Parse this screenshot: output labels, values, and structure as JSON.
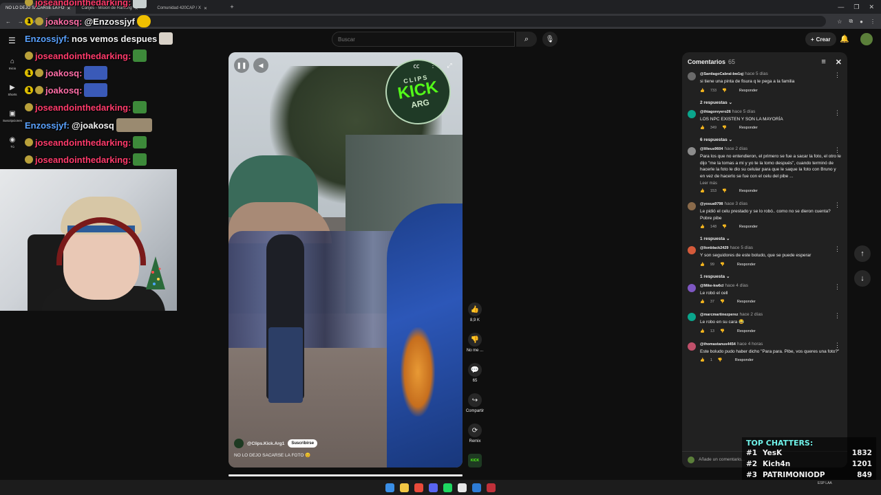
{
  "browser": {
    "tabs": [
      {
        "label": "NO LO DEJO SACARSE LA FO",
        "active": true
      },
      {
        "label": "Canjes - Misión de Ranking",
        "active": false
      },
      {
        "label": "Comunidad 420CAP / X",
        "active": false
      }
    ],
    "new_tab": "+",
    "win_controls": [
      "—",
      "❐",
      "✕"
    ]
  },
  "youtube": {
    "search_placeholder": "Buscar",
    "create_label": "Crear",
    "nav": [
      {
        "label": "Inicio",
        "icon": "home-icon",
        "glyph": "⌂"
      },
      {
        "label": "Shorts",
        "icon": "shorts-icon",
        "glyph": "▶"
      },
      {
        "label": "Suscripciones",
        "icon": "subscriptions-icon",
        "glyph": "▣"
      },
      {
        "label": "Tú",
        "icon": "you-icon",
        "glyph": "◉"
      }
    ]
  },
  "stream_chat": [
    {
      "user": "joseandointhedarking:",
      "color": "#ff3b6b",
      "msg": ""
    },
    {
      "user": "joakosq:",
      "color": "#ff6fa8",
      "msg": "@Enzossjyf"
    },
    {
      "user": "Enzossjyf:",
      "color": "#5aa2ff",
      "msg": "nos vemos despues"
    },
    {
      "user": "joseandointhedarking:",
      "color": "#ff3b6b",
      "msg": ""
    },
    {
      "user": "joakosq:",
      "color": "#ff6fa8",
      "msg": ""
    },
    {
      "user": "joakosq:",
      "color": "#ff6fa8",
      "msg": ""
    },
    {
      "user": "joseandointhedarking:",
      "color": "#ff3b6b",
      "msg": ""
    },
    {
      "user": "Enzossjyf:",
      "color": "#5aa2ff",
      "msg": "@joakosq"
    },
    {
      "user": "joseandointhedarking:",
      "color": "#ff3b6b",
      "msg": ""
    },
    {
      "user": "joseandointhedarking:",
      "color": "#ff3b6b",
      "msg": ""
    }
  ],
  "video": {
    "logo_top": "CLIPS",
    "logo_mid": "KICK",
    "logo_bot": "ARG",
    "channel": "@Clips.Kick.Arg1",
    "subscribe": "Suscribirse",
    "title": "NO LO DEJO SACARSE LA FOTO 😊",
    "actions": [
      {
        "name": "like",
        "icon": "like-icon",
        "glyph": "👍",
        "label": "8,9 K"
      },
      {
        "name": "dislike",
        "icon": "dislike-icon",
        "glyph": "👎",
        "label": "No me ..."
      },
      {
        "name": "comments",
        "icon": "comment-icon",
        "glyph": "💬",
        "label": "65"
      },
      {
        "name": "share",
        "icon": "share-icon",
        "glyph": "↪",
        "label": "Compartir"
      },
      {
        "name": "remix",
        "icon": "remix-icon",
        "glyph": "⟳",
        "label": "Remix"
      }
    ]
  },
  "comments_panel": {
    "title": "Comentarios",
    "count": "65",
    "input_placeholder": "Añade un comentario...",
    "items": [
      {
        "user": "@SantiagoCabral-bw1qj",
        "time": "hace 5 días",
        "text": "si tiene una pinta de fisura q le pega a la familia",
        "likes": "733",
        "avatar": "#6a6a6a",
        "replies": "2 respuestas"
      },
      {
        "user": "@thiagoreyero26",
        "time": "hace 5 días",
        "text": "LOS NPC EXISTEN Y SON LA MAYORÍA",
        "likes": "349",
        "avatar": "#0aa58c",
        "replies": "6 respuestas"
      },
      {
        "user": "@lilteus9604",
        "time": "hace 2 días",
        "text": "Para los que no entendieron, el primero se fue a sacar la foto, el otro le dijo \"me la tomas a mi y yo te la tomo después\", cuando terminó de hacerle la foto le dio su celular para que le saque la foto con Bruno y en vez de hacerlo se fue con el celu del pibe ...",
        "readmore": "Leer más",
        "likes": "153",
        "avatar": "#8c8c8c",
        "replies": ""
      },
      {
        "user": "@yosua9798",
        "time": "hace 3 días",
        "text": "Le pidió el celu prestado y se lo robó.. como no se dieron cuenta? Pobre pibe",
        "likes": "148",
        "avatar": "#8a6a4a",
        "replies": "1 respuesta"
      },
      {
        "user": "@lionblack2429",
        "time": "hace 5 días",
        "text": "Y son seguidores de este boludo, que se puede esperar",
        "likes": "99",
        "avatar": "#d45a3a",
        "replies": "1 respuesta"
      },
      {
        "user": "@Mike-kw6cl",
        "time": "hace 4 días",
        "text": "Le robó el cell",
        "likes": "37",
        "avatar": "#7e57c2",
        "replies": ""
      },
      {
        "user": "@marcmartinezperez",
        "time": "hace 2 días",
        "text": "Le robo en su cara 😂",
        "likes": "13",
        "avatar": "#0aa58c",
        "replies": ""
      },
      {
        "user": "@thomastanus4454",
        "time": "hace 4 horas",
        "text": "Este boludo pudo haber dicho \"Para para. Pibe, vos queres una foto?\"",
        "likes": "1",
        "avatar": "#c0506a",
        "replies": ""
      }
    ],
    "reply_label": "Responder"
  },
  "top_chatters": {
    "title": "TOP CHATTERS:",
    "rows": [
      {
        "rank": "#1",
        "name": "YesK",
        "count": "1832"
      },
      {
        "rank": "#2",
        "name": "Kich4n",
        "count": "1201"
      },
      {
        "rank": "#3",
        "name": "PATRIMONIODP",
        "count": "849"
      }
    ]
  },
  "taskbar_icons": [
    "#3a8ee6",
    "#f2c744",
    "#e94a3a",
    "#5865f2",
    "#1ed760",
    "#e9e9e9",
    "#2d7cd6",
    "#c0303a"
  ],
  "tray": {
    "lang": "ESP\nLAA"
  }
}
